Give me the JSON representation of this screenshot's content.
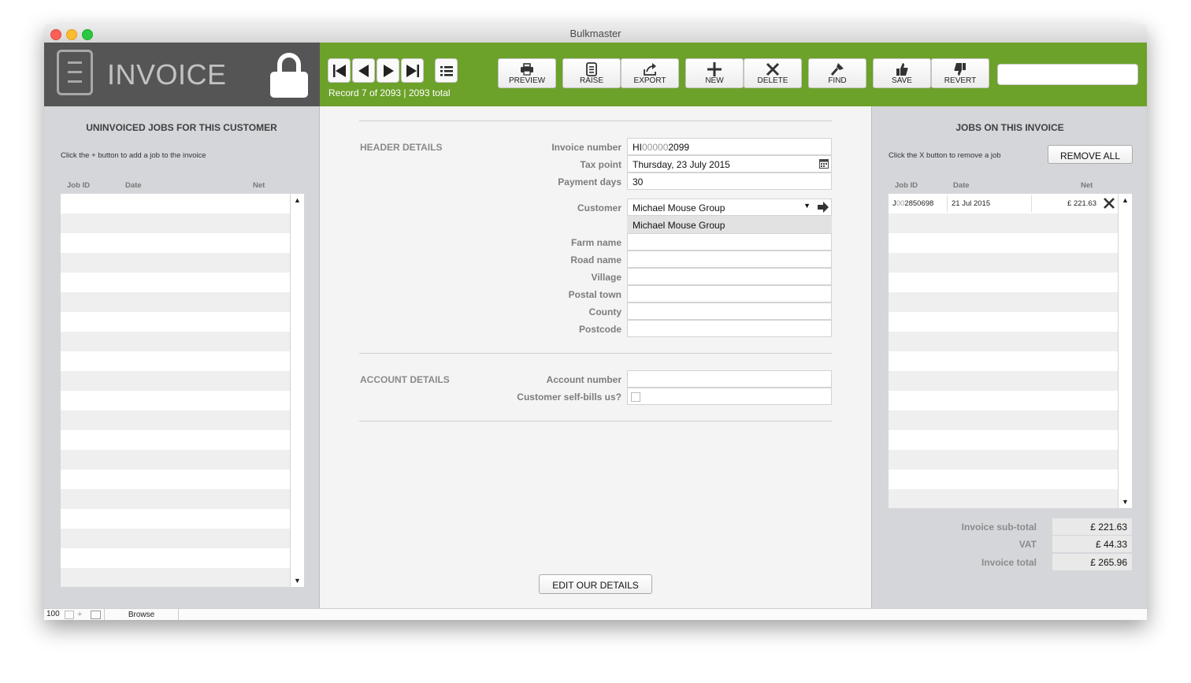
{
  "window": {
    "title": "Bulkmaster"
  },
  "module": {
    "title": "INVOICE"
  },
  "navigation": {
    "record_info": "Record 7 of 2093 | 2093 total"
  },
  "toolbar": {
    "preview": "PREVIEW",
    "raise": "RAISE",
    "export": "EXPORT",
    "new": "NEW",
    "delete": "DELETE",
    "find": "FIND",
    "save": "SAVE",
    "revert": "REVERT"
  },
  "search": {
    "value": ""
  },
  "left_panel": {
    "heading": "UNINVOICED JOBS FOR THIS CUSTOMER",
    "hint": "Click the + button to add a job to the invoice",
    "columns": [
      "Job ID",
      "Date",
      "Net"
    ]
  },
  "header_details": {
    "section_title": "HEADER DETAILS",
    "invoice_number_label": "Invoice number",
    "invoice_number_prefix": "HI",
    "invoice_number_zeros": "00000",
    "invoice_number_suffix": "2099",
    "tax_point_label": "Tax point",
    "tax_point": "Thursday, 23 July 2015",
    "payment_days_label": "Payment days",
    "payment_days": "30",
    "customer_label": "Customer",
    "customer": "Michael Mouse Group",
    "customer_display": "Michael Mouse Group",
    "farm_name_label": "Farm name",
    "farm_name": "",
    "road_name_label": "Road name",
    "road_name": "",
    "village_label": "Village",
    "village": "",
    "postal_town_label": "Postal town",
    "postal_town": "",
    "county_label": "County",
    "county": "",
    "postcode_label": "Postcode",
    "postcode": ""
  },
  "account_details": {
    "section_title": "ACCOUNT DETAILS",
    "account_number_label": "Account number",
    "account_number": "",
    "self_bills_label": "Customer self-bills us?",
    "self_bills": false
  },
  "edit_details_button": "EDIT OUR DETAILS",
  "right_panel": {
    "heading": "JOBS ON THIS INVOICE",
    "hint": "Click the X button to remove a job",
    "remove_all": "REMOVE ALL",
    "columns": [
      "Job ID",
      "Date",
      "Net"
    ],
    "jobs": [
      {
        "job_id_prefix": "J",
        "job_id_zeros": "00",
        "job_id_suffix": "2850698",
        "date": "21 Jul 2015",
        "net": "£ 221.63"
      }
    ]
  },
  "totals": {
    "subtotal_label": "Invoice sub-total",
    "subtotal": "£ 221.63",
    "vat_label": "VAT",
    "vat": "£ 44.33",
    "total_label": "Invoice total",
    "total": "£ 265.96"
  },
  "statusbar": {
    "zoom": "100",
    "mode": "Browse"
  },
  "colors": {
    "toolbar_green": "#6ca12a",
    "header_dark": "#555555",
    "panel_grey": "#d4d6da"
  }
}
